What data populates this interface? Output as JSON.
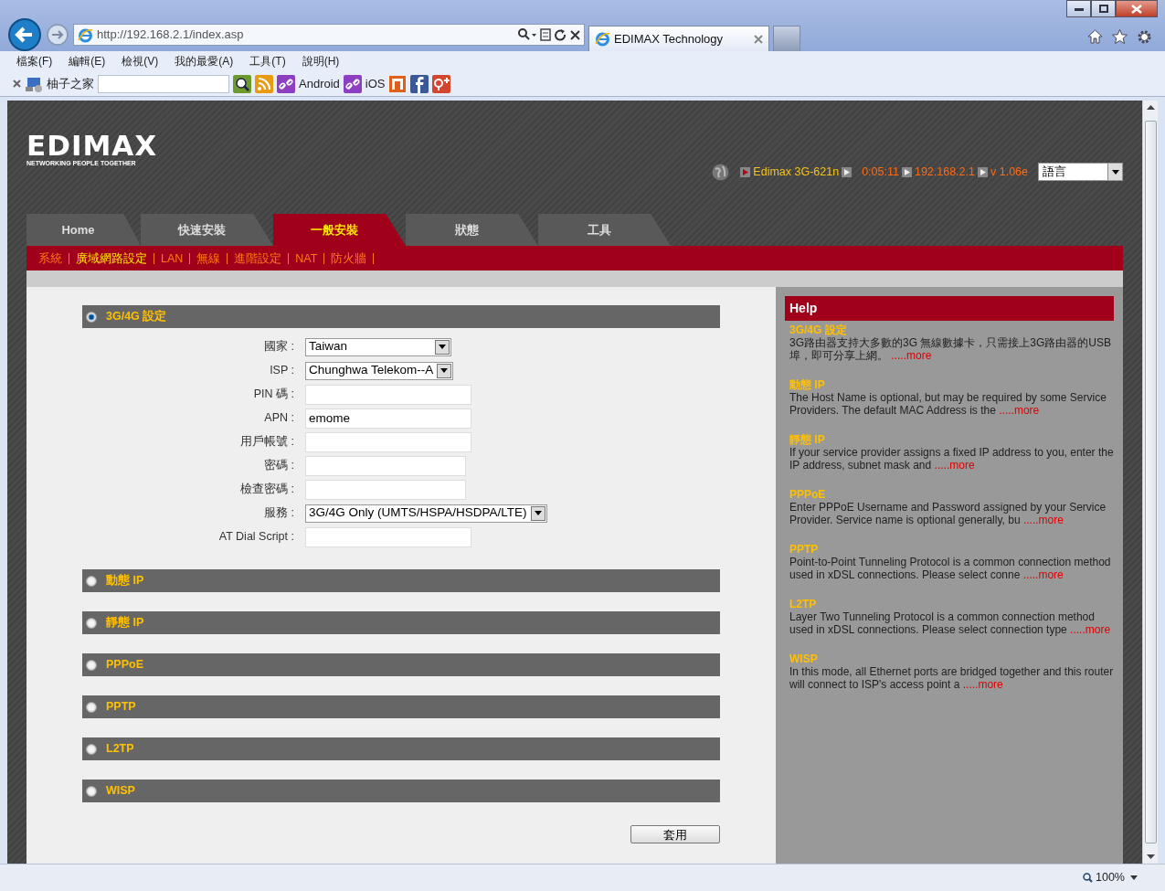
{
  "browser": {
    "url": "http://192.168.2.1/index.asp",
    "tab_title": "EDIMAX Technology",
    "menu": [
      "檔案(F)",
      "編輯(E)",
      "檢視(V)",
      "我的最愛(A)",
      "工具(T)",
      "說明(H)"
    ],
    "favorites": [
      {
        "kind": "site",
        "label": "柚子之家"
      },
      {
        "kind": "search"
      },
      {
        "kind": "rss"
      },
      {
        "kind": "link",
        "label": "Android"
      },
      {
        "kind": "link",
        "label": "iOS"
      },
      {
        "kind": "square"
      },
      {
        "kind": "facebook"
      },
      {
        "kind": "gplus"
      }
    ],
    "zoom": "100%"
  },
  "header": {
    "logo": "EDIMAX",
    "tagline": "NETWORKING PEOPLE TOGETHER",
    "device": "Edimax 3G-621n",
    "uptime": "0:05:11",
    "ip": "192.168.2.1",
    "version": "v 1.06e",
    "language": "語言"
  },
  "tabs": [
    {
      "label": "Home",
      "selected": false
    },
    {
      "label": "快速安裝",
      "selected": false
    },
    {
      "label": "一般安裝",
      "selected": true
    },
    {
      "label": "狀態",
      "selected": false
    },
    {
      "label": "工具",
      "selected": false
    }
  ],
  "subnav": [
    {
      "label": "系統",
      "selected": false
    },
    {
      "label": "廣域網路設定",
      "selected": true
    },
    {
      "label": "LAN",
      "selected": false
    },
    {
      "label": "無線",
      "selected": false
    },
    {
      "label": "進階設定",
      "selected": false
    },
    {
      "label": "NAT",
      "selected": false
    },
    {
      "label": "防火牆",
      "selected": false
    }
  ],
  "sections": [
    {
      "label": "3G/4G 設定",
      "selected": true
    },
    {
      "label": "動態 IP",
      "selected": false
    },
    {
      "label": "靜態 IP",
      "selected": false
    },
    {
      "label": "PPPoE",
      "selected": false
    },
    {
      "label": "PPTP",
      "selected": false
    },
    {
      "label": "L2TP",
      "selected": false
    },
    {
      "label": "WISP",
      "selected": false
    }
  ],
  "form": [
    {
      "label": "國家 :",
      "kind": "select",
      "value": "Taiwan"
    },
    {
      "label": "ISP :",
      "kind": "select",
      "value": "Chunghwa Telekom--A"
    },
    {
      "label": "PIN 碼 :",
      "kind": "text"
    },
    {
      "label": "APN :",
      "kind": "text",
      "value": "emome"
    },
    {
      "label": "用戶帳號 :",
      "kind": "text"
    },
    {
      "label": "密碼 :",
      "kind": "password"
    },
    {
      "label": "檢查密碼 :",
      "kind": "password"
    },
    {
      "label": "服務 :",
      "kind": "select",
      "value": "3G/4G Only (UMTS/HSPA/HSDPA/LTE)"
    },
    {
      "label": "AT Dial Script :",
      "kind": "text"
    }
  ],
  "apply": "套用",
  "help": {
    "title": "Help",
    "items": [
      {
        "title": "3G/4G 設定",
        "text": "3G路由器支持大多數的3G 無線數據卡，只需接上3G路由器的USB埠，即可分享上網。",
        "more": ".....more"
      },
      {
        "title": "動態 IP",
        "text": "The Host Name is optional, but may be required by some Service Providers. The default MAC Address is the",
        "more": ".....more"
      },
      {
        "title": "靜態 IP",
        "text": "If your service provider assigns a fixed IP address to you, enter the IP address, subnet mask and",
        "more": ".....more"
      },
      {
        "title": "PPPoE",
        "text": "Enter PPPoE Username and Password assigned by your Service Provider. Service name is optional generally, bu",
        "more": ".....more"
      },
      {
        "title": "PPTP",
        "text": "Point-to-Point Tunneling Protocol is a common connection method used in xDSL connections. Please select conne",
        "more": ".....more"
      },
      {
        "title": "L2TP",
        "text": "Layer Two Tunneling Protocol is a common connection method used in xDSL connections. Please select connection type",
        "more": ".....more"
      },
      {
        "title": "WISP",
        "text": "In this mode, all Ethernet ports are bridged together and this router will connect to ISP's access point a",
        "more": ".....more"
      }
    ]
  }
}
